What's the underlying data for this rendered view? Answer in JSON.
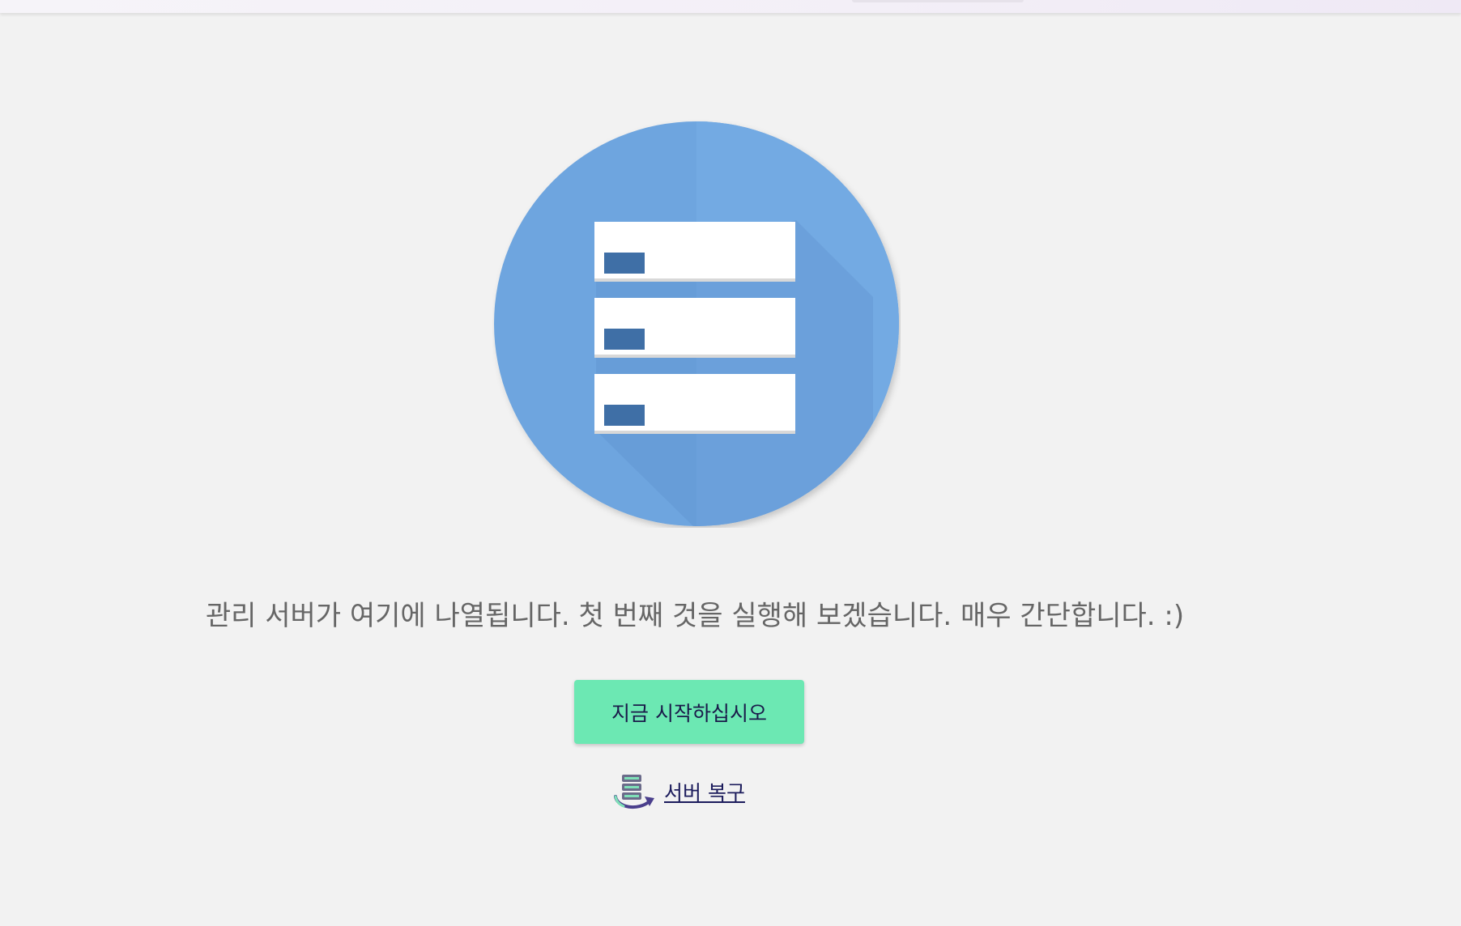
{
  "main": {
    "hero_icon": "server-list-icon",
    "message": "관리 서버가 여기에 나열됩니다. 첫 번째 것을 실행해 보겠습니다. 매우 간단합니다. :)",
    "start_button_label": "지금 시작하십시오",
    "restore_link_label": "서버 복구",
    "restore_icon": "server-restore-icon"
  },
  "colors": {
    "background": "#f2f2f2",
    "circle": "#6ea5df",
    "accent_button": "#6ce8b3",
    "link": "#1c1c5c",
    "text": "#666666"
  }
}
